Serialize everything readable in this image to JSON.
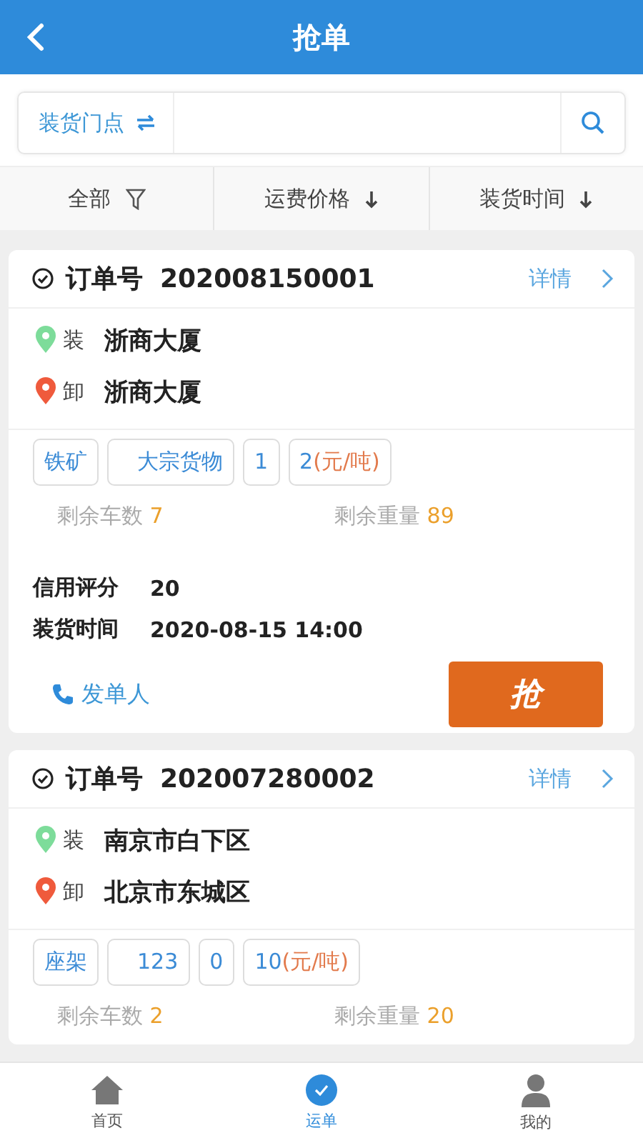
{
  "header": {
    "title": "抢单"
  },
  "search": {
    "store_label": "装货门点"
  },
  "filters": [
    {
      "label": "全部",
      "kind": "filter"
    },
    {
      "label": "运费价格",
      "kind": "sort"
    },
    {
      "label": "装货时间",
      "kind": "sort"
    }
  ],
  "orders": [
    {
      "order_label": "订单号",
      "order_no": "202008150001",
      "detail": "详情",
      "load_label": "装",
      "load": "浙商大厦",
      "unload_label": "卸",
      "unload": "浙商大厦",
      "tags": [
        {
          "kind": "text",
          "label": "铁矿"
        },
        {
          "kind": "text",
          "label": "大宗货物"
        },
        {
          "kind": "text",
          "label": "1"
        },
        {
          "kind": "price",
          "value": "2",
          "unit": "(元/吨)"
        }
      ],
      "remaining_trucks_label": "剩余车数",
      "remaining_trucks": "7",
      "remaining_weight_label": "剩余重量",
      "remaining_weight": "89",
      "credit_label": "信用评分",
      "credit": "20",
      "time_label": "装货时间",
      "time": "2020-08-15 14:00",
      "contact": "发单人",
      "grab": "抢"
    },
    {
      "order_label": "订单号",
      "order_no": "202007280002",
      "detail": "详情",
      "load_label": "装",
      "load": "南京市白下区",
      "unload_label": "卸",
      "unload": "北京市东城区",
      "tags": [
        {
          "kind": "text",
          "label": "座架"
        },
        {
          "kind": "text",
          "label": "123"
        },
        {
          "kind": "text",
          "label": "0"
        },
        {
          "kind": "price",
          "value": "10",
          "unit": "(元/吨)"
        }
      ],
      "remaining_trucks_label": "剩余车数",
      "remaining_trucks": "2",
      "remaining_weight_label": "剩余重量",
      "remaining_weight": "20"
    }
  ],
  "tabbar": [
    {
      "label": "首页",
      "kind": "home",
      "selected": false
    },
    {
      "label": "运单",
      "kind": "orders",
      "selected": true
    },
    {
      "label": "我的",
      "kind": "me",
      "selected": false
    }
  ]
}
